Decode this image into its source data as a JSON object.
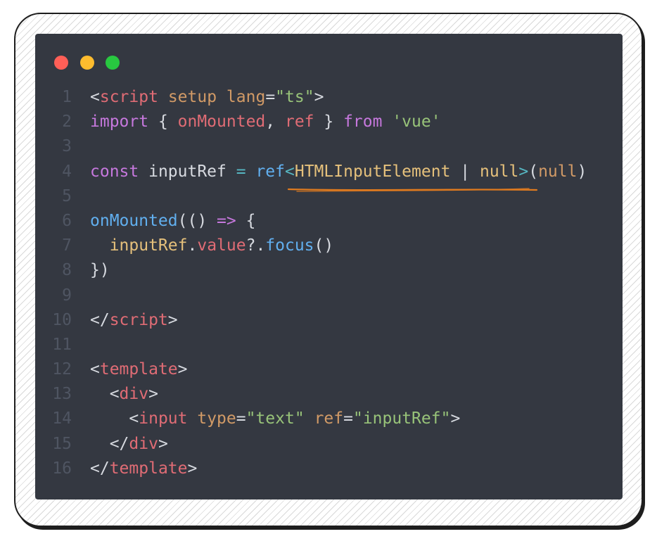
{
  "window": {
    "controls": [
      "close-dot",
      "minimize-dot",
      "maximize-dot"
    ],
    "colors": {
      "background": "#343841",
      "close": "#ff5f57",
      "minimize": "#febc2e",
      "maximize": "#28c840",
      "underline": "#e07b1f"
    }
  },
  "code": {
    "lines": [
      {
        "n": "1",
        "tokens": [
          [
            "<",
            "#d7dae0"
          ],
          [
            "script",
            "#e06c75"
          ],
          [
            " ",
            "#d7dae0"
          ],
          [
            "setup",
            "#d19a66"
          ],
          [
            " ",
            "#d7dae0"
          ],
          [
            "lang",
            "#d19a66"
          ],
          [
            "=",
            "#d7dae0"
          ],
          [
            "\"ts\"",
            "#98c379"
          ],
          [
            ">",
            "#d7dae0"
          ]
        ]
      },
      {
        "n": "2",
        "tokens": [
          [
            "import",
            "#c678dd"
          ],
          [
            " { ",
            "#d7dae0"
          ],
          [
            "onMounted",
            "#e06c75"
          ],
          [
            ", ",
            "#d7dae0"
          ],
          [
            "ref",
            "#e06c75"
          ],
          [
            " } ",
            "#d7dae0"
          ],
          [
            "from",
            "#c678dd"
          ],
          [
            " ",
            "#d7dae0"
          ],
          [
            "'vue'",
            "#98c379"
          ]
        ]
      },
      {
        "n": "3",
        "tokens": []
      },
      {
        "n": "4",
        "tokens": [
          [
            "const",
            "#c678dd"
          ],
          [
            " inputRef ",
            "#d7dae0"
          ],
          [
            "=",
            "#56b6c2"
          ],
          [
            " ",
            "#d7dae0"
          ],
          [
            "ref",
            "#61afef"
          ],
          [
            "<",
            "#56b6c2"
          ],
          [
            "HTMLInputElement",
            "#e5c07b"
          ],
          [
            " | ",
            "#d7dae0"
          ],
          [
            "null",
            "#e5c07b"
          ],
          [
            ">",
            "#56b6c2"
          ],
          [
            "(",
            "#d7dae0"
          ],
          [
            "null",
            "#d19a66"
          ],
          [
            ")",
            "#d7dae0"
          ]
        ]
      },
      {
        "n": "5",
        "tokens": []
      },
      {
        "n": "6",
        "tokens": [
          [
            "onMounted",
            "#61afef"
          ],
          [
            "(() ",
            "#d7dae0"
          ],
          [
            "=>",
            "#c678dd"
          ],
          [
            " {",
            "#d7dae0"
          ]
        ]
      },
      {
        "n": "7",
        "tokens": [
          [
            "  inputRef",
            "#e5c07b"
          ],
          [
            ".",
            "#d7dae0"
          ],
          [
            "value",
            "#e06c75"
          ],
          [
            "?.",
            "#d7dae0"
          ],
          [
            "focus",
            "#61afef"
          ],
          [
            "()",
            "#d7dae0"
          ]
        ]
      },
      {
        "n": "8",
        "tokens": [
          [
            "})",
            "#d7dae0"
          ]
        ]
      },
      {
        "n": "9",
        "tokens": []
      },
      {
        "n": "10",
        "tokens": [
          [
            "</",
            "#d7dae0"
          ],
          [
            "script",
            "#e06c75"
          ],
          [
            ">",
            "#d7dae0"
          ]
        ]
      },
      {
        "n": "11",
        "tokens": []
      },
      {
        "n": "12",
        "tokens": [
          [
            "<",
            "#d7dae0"
          ],
          [
            "template",
            "#e06c75"
          ],
          [
            ">",
            "#d7dae0"
          ]
        ]
      },
      {
        "n": "13",
        "tokens": [
          [
            "  <",
            "#d7dae0"
          ],
          [
            "div",
            "#e06c75"
          ],
          [
            ">",
            "#d7dae0"
          ]
        ]
      },
      {
        "n": "14",
        "tokens": [
          [
            "    <",
            "#d7dae0"
          ],
          [
            "input",
            "#e06c75"
          ],
          [
            " ",
            "#d7dae0"
          ],
          [
            "type",
            "#d19a66"
          ],
          [
            "=",
            "#d7dae0"
          ],
          [
            "\"text\"",
            "#98c379"
          ],
          [
            " ",
            "#d7dae0"
          ],
          [
            "ref",
            "#d19a66"
          ],
          [
            "=",
            "#d7dae0"
          ],
          [
            "\"inputRef\"",
            "#98c379"
          ],
          [
            ">",
            "#d7dae0"
          ]
        ]
      },
      {
        "n": "15",
        "tokens": [
          [
            "  </",
            "#d7dae0"
          ],
          [
            "div",
            "#e06c75"
          ],
          [
            ">",
            "#d7dae0"
          ]
        ]
      },
      {
        "n": "16",
        "tokens": [
          [
            "</",
            "#d7dae0"
          ],
          [
            "template",
            "#e06c75"
          ],
          [
            ">",
            "#d7dae0"
          ]
        ]
      }
    ]
  }
}
